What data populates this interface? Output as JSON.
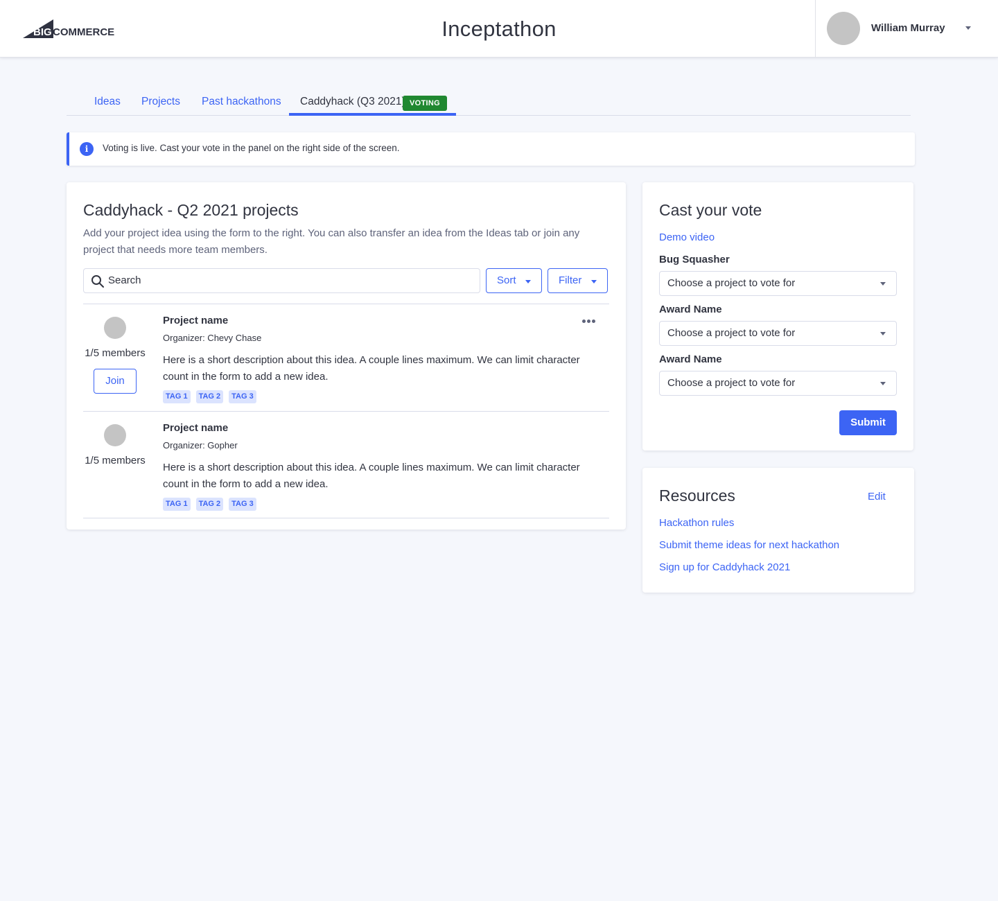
{
  "header": {
    "logo_text": "BIGCOMMERCE",
    "app_title": "Inceptathon",
    "user": {
      "name": "William Murray"
    }
  },
  "tabs": [
    {
      "label": "Ideas",
      "active": false
    },
    {
      "label": "Projects",
      "active": false
    },
    {
      "label": "Past hackathons",
      "active": false
    },
    {
      "label": "Caddyhack (Q3 2021)",
      "active": true,
      "badge": "VOTING"
    }
  ],
  "banner": {
    "icon": "info-icon",
    "text": "Voting is live. Cast your vote in the panel on the right side of the screen."
  },
  "projects_panel": {
    "title": "Caddyhack - Q2 2021 projects",
    "description": "Add your project idea using the form to the right. You can also transfer an idea from the Ideas tab or join any project that needs more team members.",
    "search": {
      "placeholder": "Search",
      "value": ""
    },
    "sort_label": "Sort",
    "filter_label": "Filter",
    "projects": [
      {
        "name": "Project name",
        "organizer": "Organizer: Chevy Chase",
        "members": "1/5 members",
        "join_label": "Join",
        "description": "Here is a short description about this idea. A couple lines maximum. We can limit character count in the form to add a new idea.",
        "tags": [
          "TAG 1",
          "TAG 2",
          "TAG 3"
        ]
      },
      {
        "name": "Project name",
        "organizer": "Organizer: Gopher",
        "members": "1/5 members",
        "description": "Here is a short description about this idea. A couple lines maximum. We can limit character count in the form to add a new idea.",
        "tags": [
          "TAG 1",
          "TAG 2",
          "TAG 3"
        ]
      }
    ]
  },
  "vote_panel": {
    "title": "Cast your vote",
    "demo_link": "Demo video",
    "awards": [
      {
        "label": "Bug Squasher",
        "selected": "Choose a project to vote for"
      },
      {
        "label": "Award Name",
        "selected": "Choose a project to vote for"
      },
      {
        "label": "Award Name",
        "selected": "Choose a project to vote for"
      }
    ],
    "submit_label": "Submit"
  },
  "resources_panel": {
    "title": "Resources",
    "edit_label": "Edit",
    "links": [
      "Hackathon rules",
      "Submit theme ideas for next hackathon",
      "Sign up for Caddyhack 2021"
    ]
  },
  "colors": {
    "primary": "#3c64f4",
    "success": "#208831",
    "background": "#f5f7fc",
    "text": "#313440",
    "tag_bg": "#dbe3fe"
  }
}
